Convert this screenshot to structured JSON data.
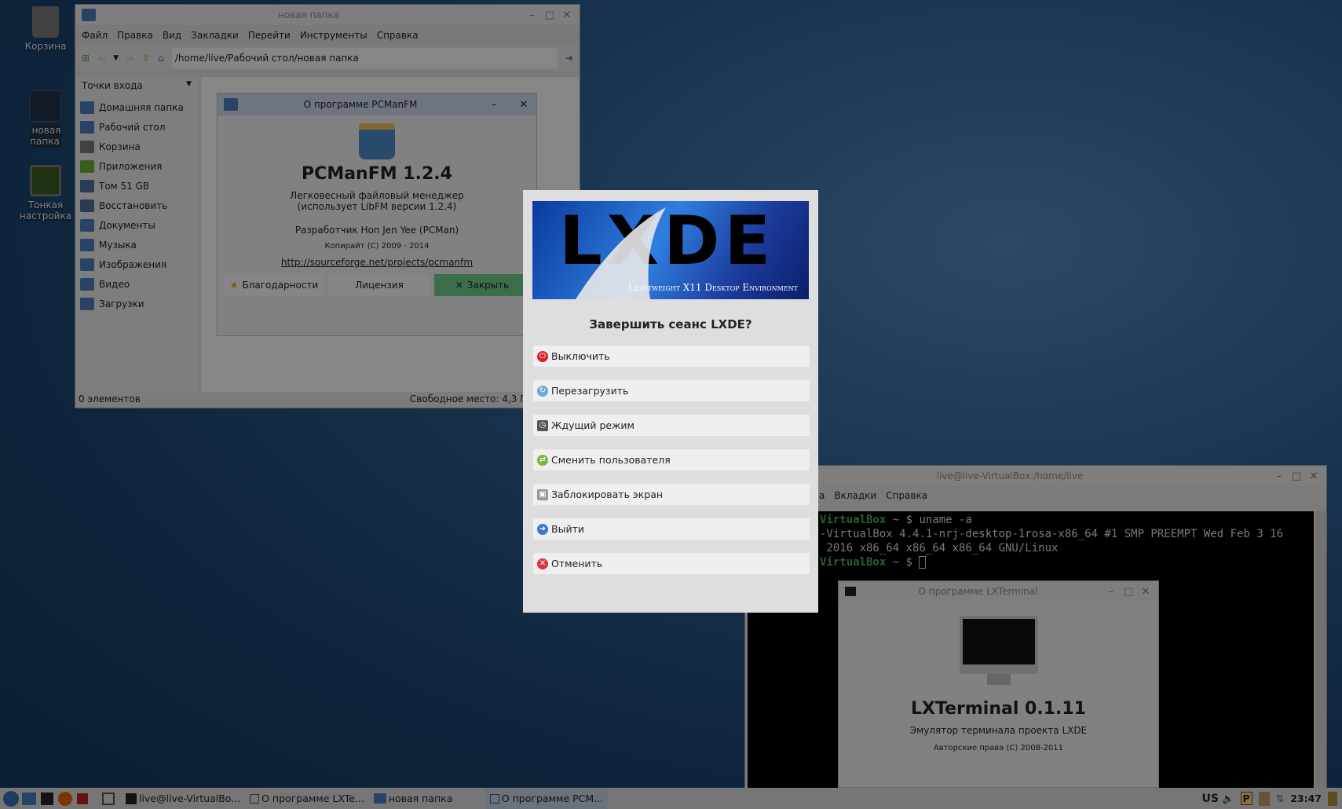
{
  "desktop": {
    "icons": [
      {
        "label": "Корзина"
      },
      {
        "label": "новая папка"
      },
      {
        "label": "Тонкая настройка"
      }
    ]
  },
  "pcmanfm": {
    "title": "новая папка",
    "menu": [
      "Файл",
      "Правка",
      "Вид",
      "Закладки",
      "Перейти",
      "Инструменты",
      "Справка"
    ],
    "path": "/home/live/Рабочий стол/новая папка",
    "sidebar_header": "Точки входа",
    "places": [
      "Домашняя папка",
      "Рабочий стол",
      "Корзина",
      "Приложения",
      "Том 51 GB",
      "Восстановить",
      "Документы",
      "Музыка",
      "Изображения",
      "Видео",
      "Загрузки"
    ],
    "status_left": "0 элементов",
    "status_right": "Свободное место: 4,3 ГиБ (Всего:"
  },
  "pcman_about": {
    "title": "О программе PCManFM",
    "name": "PCManFM 1.2.4",
    "desc1": "Легковесный файловый менеджер",
    "desc2": "(использует LibFM версии 1.2.4)",
    "dev": "Разработчик Hon Jen Yee (PCMan)",
    "copyright": "Копирайт (C) 2009 - 2014",
    "url": "http://sourceforge.net/projects/pcmanfm",
    "btn_credits": "Благодарности",
    "btn_license": "Лицензия",
    "btn_close": "Закрыть"
  },
  "logout": {
    "banner_logo": "LXDE",
    "banner_sub": "Lightweight X11 Desktop Environment",
    "question": "Завершить сеанс LXDE?",
    "options": [
      {
        "label": "Выключить",
        "color": "#d9242a"
      },
      {
        "label": "Перезагрузить",
        "color": "#6fa4dc"
      },
      {
        "label": "Ждущий режим",
        "color": "#555555"
      },
      {
        "label": "Сменить пользователя",
        "color": "#7cb342"
      },
      {
        "label": "Заблокировать экран",
        "color": "#999999"
      },
      {
        "label": "Выйти",
        "color": "#3a78c9"
      },
      {
        "label": "Отменить",
        "color": "#d9373b"
      }
    ]
  },
  "terminal": {
    "title": "live@live-VirtualBox:/home/live",
    "menu": [
      "а",
      "Вкладки",
      "Справка"
    ],
    "lines": [
      {
        "host": "VirtualBox",
        "rest": " ~ $ uname -a"
      },
      {
        "text": "-VirtualBox 4.4.1-nrj-desktop-1rosa-x86_64 #1 SMP PREEMPT Wed Feb 3 16"
      },
      {
        "text": " 2016 x86_64 x86_64 x86_64 GNU/Linux"
      },
      {
        "host": "VirtualBox",
        "rest": " ~ $ "
      }
    ]
  },
  "lxterm_about": {
    "title": "О программе LXTerminal",
    "name": "LXTerminal 0.1.11",
    "desc": "Эмулятор терминала проекта LXDE",
    "copyright": "Авторские права (C) 2008-2011"
  },
  "taskbar": {
    "tasks": [
      "live@live-VirtualBo...",
      "О программе LXTe...",
      "новая папка",
      "О программе PCM..."
    ],
    "layout": "US",
    "clock": "23:47"
  }
}
